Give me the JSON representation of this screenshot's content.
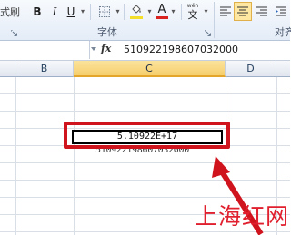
{
  "ribbon": {
    "left_fragment": "式刷",
    "font_group_label": "字体",
    "align_fragment": "对齐",
    "bold": "B",
    "italic": "I",
    "underline": "U",
    "font_color_letter": "A",
    "wen_icon_text": "wén",
    "wen_char": "文",
    "font_color_swatch": "#d9231f",
    "fill_color_swatch": "#f3df2b"
  },
  "formula_bar": {
    "fx_label": "fx",
    "content": "510922198607032000"
  },
  "columns": [
    "B",
    "C",
    "D"
  ],
  "sheet": {
    "active_cell_display": "5.10922E+17",
    "overflow_text": "510922198607032000"
  },
  "annotation": {
    "frame_color": "#d0141e",
    "watermark": "上海红网"
  }
}
